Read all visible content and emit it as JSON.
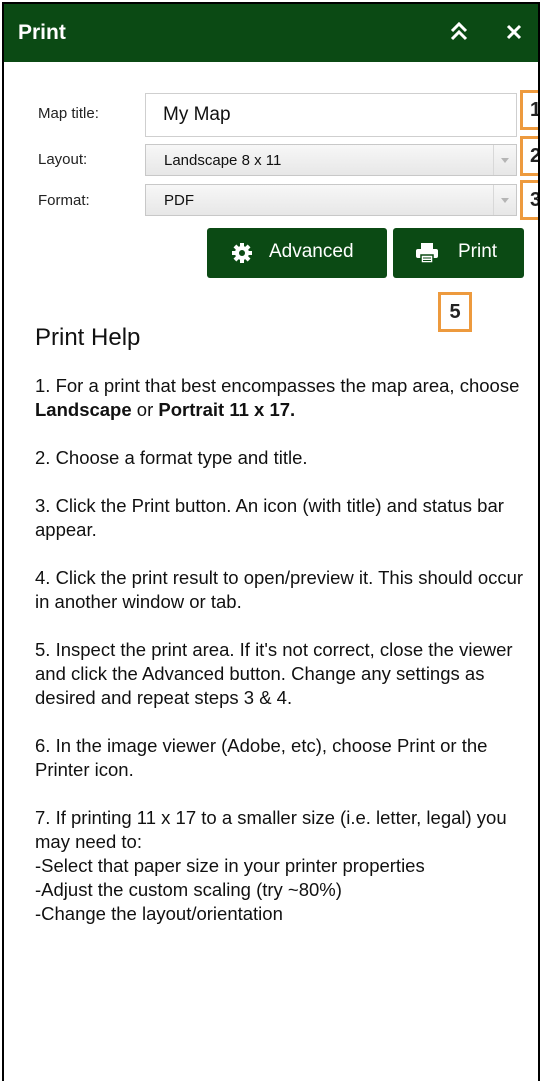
{
  "window": {
    "title": "Print"
  },
  "form": {
    "map_title_label": "Map title:",
    "map_title_value": "My Map",
    "layout_label": "Layout:",
    "layout_value": "Landscape 8 x 11",
    "format_label": "Format:",
    "format_value": "PDF"
  },
  "buttons": {
    "advanced_label": "Advanced",
    "print_label": "Print"
  },
  "badges": {
    "b1": "1",
    "b2": "2",
    "b3": "3",
    "b5": "5"
  },
  "help": {
    "heading": "Print Help",
    "step1_text_a": "1. For a print that best encompasses the map area, choose ",
    "step1_bold_a": "Landscape",
    "step1_text_b": " or ",
    "step1_bold_b": "Portrait 11 x 17.",
    "step2": "2. Choose a format type and title.",
    "step3": "3. Click the Print button. An icon (with title) and status bar appear.",
    "step4": "4. Click the print result to open/preview it. This should occur in another window or tab.",
    "step5": "5. Inspect the print area. If it's not correct, close the viewer and click the Advanced button. Change any settings as desired and repeat steps 3 & 4.",
    "step6": "6. In the image viewer (Adobe, etc), choose Print or the Printer icon.",
    "step7_intro": "7. If printing 11 x 17 to a smaller size (i.e. letter, legal) you may need to:",
    "step7_items": [
      "-Select that paper size in your printer properties",
      "-Adjust the custom scaling (try ~80%)",
      "-Change the layout/orientation"
    ]
  },
  "icons": {
    "collapse": "double-chevron-up-icon",
    "close": "close-icon",
    "advanced": "gear-icon",
    "print": "printer-icon",
    "dropdown": "chevron-down-icon"
  },
  "colors": {
    "header": "#0b4a14",
    "button": "#0b4a14",
    "badge_border": "#ed9a3e"
  }
}
